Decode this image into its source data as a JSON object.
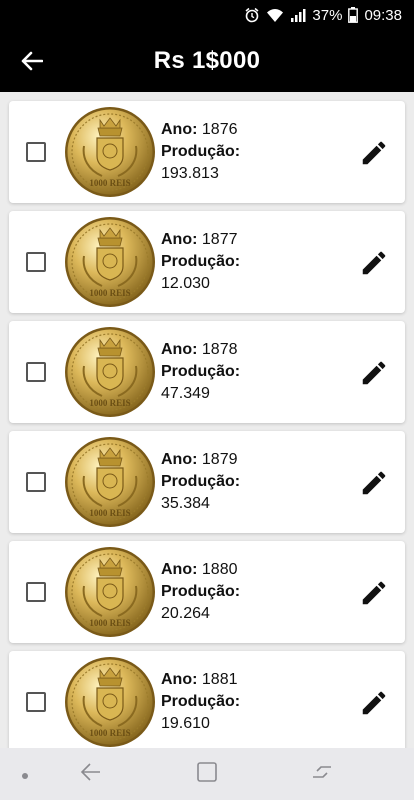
{
  "status_bar": {
    "battery": "37%",
    "time": "09:38"
  },
  "app_bar": {
    "title": "Rs 1$000"
  },
  "labels": {
    "ano": "Ano:",
    "producao": "Produção:"
  },
  "coins": [
    {
      "year": "1876",
      "production": "193.813"
    },
    {
      "year": "1877",
      "production": "12.030"
    },
    {
      "year": "1878",
      "production": "47.349"
    },
    {
      "year": "1879",
      "production": "35.384"
    },
    {
      "year": "1880",
      "production": "20.264"
    },
    {
      "year": "1881",
      "production": "19.610"
    }
  ],
  "colors": {
    "app_bar": "#000000",
    "background": "#ececec",
    "coin_gold": "#d4b048",
    "nav_bar": "#e9e9ec"
  },
  "icons": {
    "back": "arrow-left-icon",
    "edit": "pencil-icon",
    "coin": "gold-coin-image"
  }
}
